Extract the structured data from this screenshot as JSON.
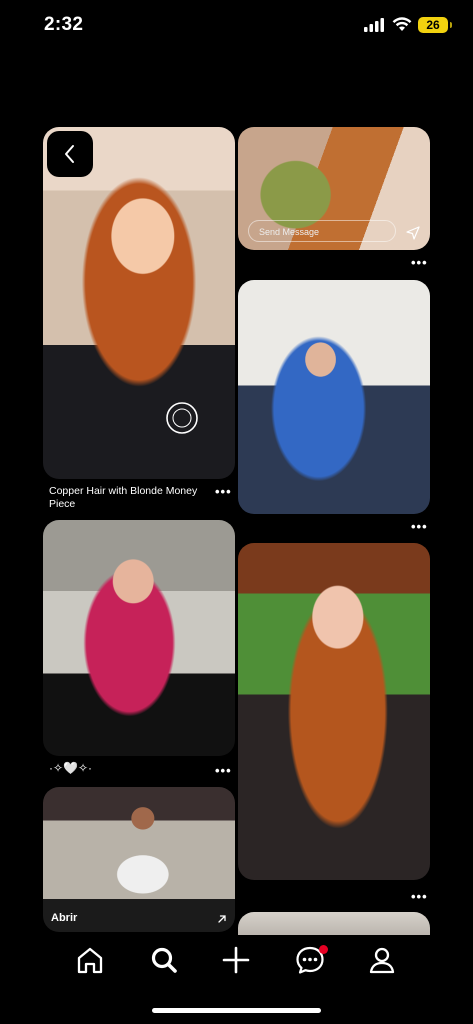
{
  "status_bar": {
    "time": "2:32",
    "battery": "26"
  },
  "feed": {
    "cards": [
      {
        "caption": "Copper Hair with Blonde Money Piece",
        "more": "•••"
      },
      {
        "message_placeholder": "Send Message",
        "more": "•••"
      },
      {
        "more": "•••"
      },
      {
        "caption": "·✧🤍✧·",
        "more": "•••"
      },
      {
        "more": "•••"
      },
      {
        "action_label": "Abrir"
      }
    ]
  },
  "nav": {
    "items": [
      "home",
      "search",
      "create",
      "messages",
      "profile"
    ],
    "notification_color": "#e60023"
  }
}
